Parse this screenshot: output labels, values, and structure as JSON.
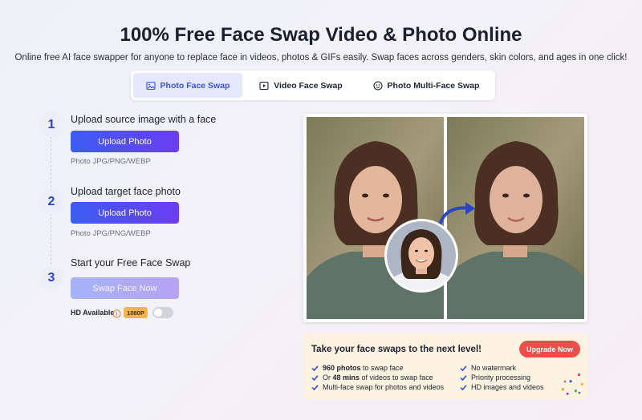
{
  "hero": {
    "title": "100% Free Face Swap Video & Photo Online",
    "subtitle": "Online free AI face swapper for anyone to replace face in videos, photos & GIFs easily. Swap faces across genders, skin colors, and ages in one click!"
  },
  "tabs": [
    {
      "label": "Photo Face Swap",
      "icon": "image-icon",
      "active": true
    },
    {
      "label": "Video Face Swap",
      "icon": "video-play-icon",
      "active": false
    },
    {
      "label": "Photo Multi-Face Swap",
      "icon": "multi-face-icon",
      "active": false
    }
  ],
  "steps": [
    {
      "number": "1",
      "title": "Upload source image with a face",
      "button": "Upload Photo",
      "hint": "Photo JPG/PNG/WEBP"
    },
    {
      "number": "2",
      "title": "Upload target face photo",
      "button": "Upload Photo",
      "hint": "Photo JPG/PNG/WEBP"
    },
    {
      "number": "3",
      "title": "Start your Free Face Swap",
      "button": "Swap Face Now"
    }
  ],
  "hd": {
    "label": "HD Available",
    "badge": "1080P",
    "enabled": false
  },
  "upgrade": {
    "title": "Take your face swaps to the next level!",
    "button": "Upgrade Now",
    "features_left": [
      {
        "bold": "960 photos",
        "text": " to swap face"
      },
      {
        "pre": "Or ",
        "bold": "48 mins",
        "text": " of videos to swap face"
      },
      {
        "text": "Multi-face swap for photos and videos"
      }
    ],
    "features_right": [
      {
        "text": "No watermark"
      },
      {
        "text": "Priority processing"
      },
      {
        "text": "HD images and videos"
      }
    ]
  },
  "colors": {
    "accent": "#3d5df2",
    "upgrade_button": "#ea4f4a",
    "badge": "#f6b54a"
  }
}
